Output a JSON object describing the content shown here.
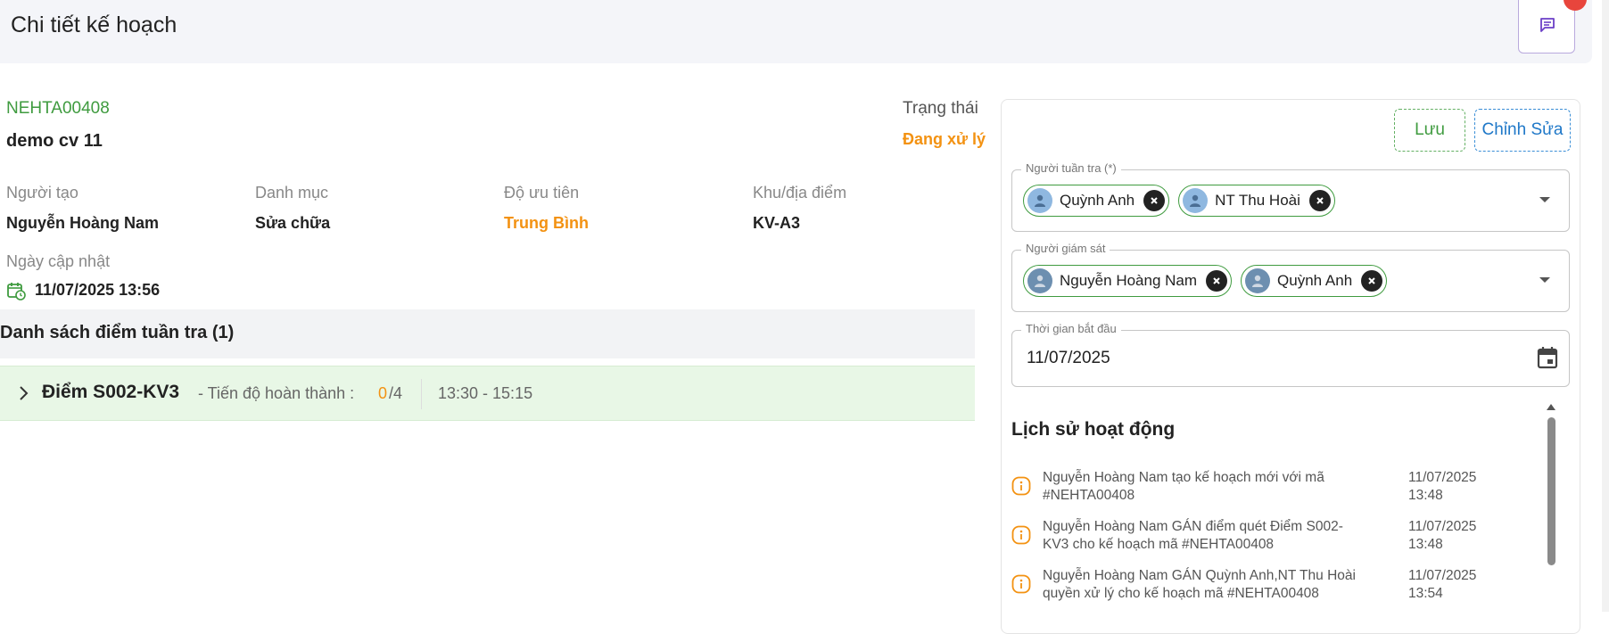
{
  "header": {
    "title": "Chi tiết kế hoạch",
    "chat_icon": "chat-icon"
  },
  "plan": {
    "code": "NEHTA00408",
    "name": "demo cv 11",
    "status_label": "Trạng thái",
    "status_value": "Đang xử lý"
  },
  "fields": {
    "creator_label": "Người tạo",
    "creator_value": "Nguyễn Hoàng Nam",
    "category_label": "Danh mục",
    "category_value": "Sửa chữa",
    "priority_label": "Độ ưu tiên",
    "priority_value": "Trung Bình",
    "area_label": "Khu/địa điểm",
    "area_value": "KV-A3",
    "updated_label": "Ngày cập nhật",
    "updated_value": "11/07/2025 13:56"
  },
  "points": {
    "title": "Danh sách điểm tuần tra (1)",
    "items": [
      {
        "name": "Điểm S002-KV3",
        "progress_label": "- Tiến độ hoàn thành :",
        "done": "0",
        "total": "/4",
        "time": "13:30 - 15:15"
      }
    ]
  },
  "panel": {
    "save_label": "Lưu",
    "edit_label": "Chỉnh Sửa",
    "patrollers_legend": "Người tuần tra (*)",
    "patrollers": [
      "Quỳnh Anh",
      "NT Thu Hoài"
    ],
    "supervisors_legend": "Người giám sát",
    "supervisors": [
      "Nguyễn Hoàng Nam",
      "Quỳnh Anh"
    ],
    "start_legend": "Thời gian bắt đầu",
    "start_value": "11/07/2025"
  },
  "history": {
    "title": "Lịch sử hoạt động",
    "items": [
      {
        "text": "Nguyễn Hoàng Nam tạo kế hoạch mới với mã #NEHTA00408",
        "time": "11/07/2025 13:48"
      },
      {
        "text": "Nguyễn Hoàng Nam GÁN điểm quét Điểm S002-KV3 cho kế hoạch mã #NEHTA00408",
        "time": "11/07/2025 13:48"
      },
      {
        "text": "Nguyễn Hoàng Nam GÁN Quỳnh Anh,NT Thu Hoài quyền xử lý cho kế hoạch mã #NEHTA00408",
        "time": "11/07/2025 13:54"
      }
    ]
  },
  "colors": {
    "green": "#3f9b3f",
    "orange": "#f39212",
    "blue": "#1f78c8"
  }
}
